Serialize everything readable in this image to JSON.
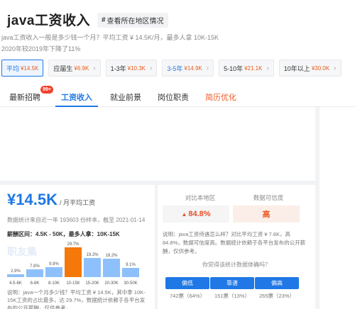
{
  "header": {
    "title": "java工资收入",
    "location_button": "查看所在地区情况",
    "desc_line1": "java工资收入一般是多少钱一个月？平均工资 ¥ 14.5K/月，最多人拿 10K-15K",
    "desc_line2": "2020年较2019年下降了11%"
  },
  "filters": [
    {
      "label": "平均",
      "salary": "¥14.5K",
      "active": true
    },
    {
      "label": "应届生",
      "salary": "¥6.9K"
    },
    {
      "label": "1-3年",
      "salary": "¥10.3K"
    },
    {
      "label": "3-5年",
      "salary": "¥14.9K"
    },
    {
      "label": "5-10年",
      "salary": "¥21.1K"
    },
    {
      "label": "10年以上",
      "salary": "¥30.0K"
    }
  ],
  "tabs": [
    {
      "label": "最新招聘",
      "badge": "99+"
    },
    {
      "label": "工资收入",
      "active": true
    },
    {
      "label": "就业前景"
    },
    {
      "label": "岗位职责"
    },
    {
      "label": "简历优化"
    }
  ],
  "salary_card": {
    "currency": "¥",
    "value": "14.5K",
    "unit": "/ 月平均工资",
    "stat_note": "数据统计来自近一年 193603 份样本，截至 2021-01-14",
    "range_note": "薪酬区间：4.5K - 50K，最多人拿：10K-15K",
    "watermark": "职友集",
    "footnote": "说明：java一个月多少钱？平均工资 ¥ 14.5K，其中拿 10K-15K工资的占比最多，达 29.7%，数据统计依赖于各平台发布的公开薪酬，仅供参考。"
  },
  "chart_data": {
    "type": "bar",
    "categories": [
      "4.5-6K",
      "6-8K",
      "8-10K",
      "10-15K",
      "15-20K",
      "20-30K",
      "30-50K"
    ],
    "values": [
      2.9,
      7.8,
      9.9,
      29.7,
      19.2,
      18.2,
      9.1
    ],
    "value_labels": [
      "2.9%",
      "7.8%",
      "9.9%",
      "29.7%",
      "19.2%",
      "18.2%",
      "9.1%"
    ],
    "highlight_index": 3,
    "colors": {
      "normal": "#8ec0fb",
      "highlight": "#f5780b"
    }
  },
  "compare_card": {
    "col1_header": "对比本地区",
    "col1_value": "84.8%",
    "col2_header": "数据可信度",
    "col2_value": "高",
    "desc": "说明：java工资待遇怎么样？对比平均工资 ¥ 7.6K，高 84.8%，数据可信度高。数据统计依赖于各平台发布的公开薪酬，仅供参考。",
    "ask": "你觉得该统计数据体确吗？",
    "votes": [
      {
        "label": "偏低",
        "count": "742票（64%）"
      },
      {
        "label": "靠谱",
        "count": "151票（13%）"
      },
      {
        "label": "偏高",
        "count": "265票（23%）"
      }
    ]
  },
  "colors": {
    "accent": "#1f78e6",
    "orange": "#f05a24",
    "highlight_bar": "#f5780b"
  }
}
